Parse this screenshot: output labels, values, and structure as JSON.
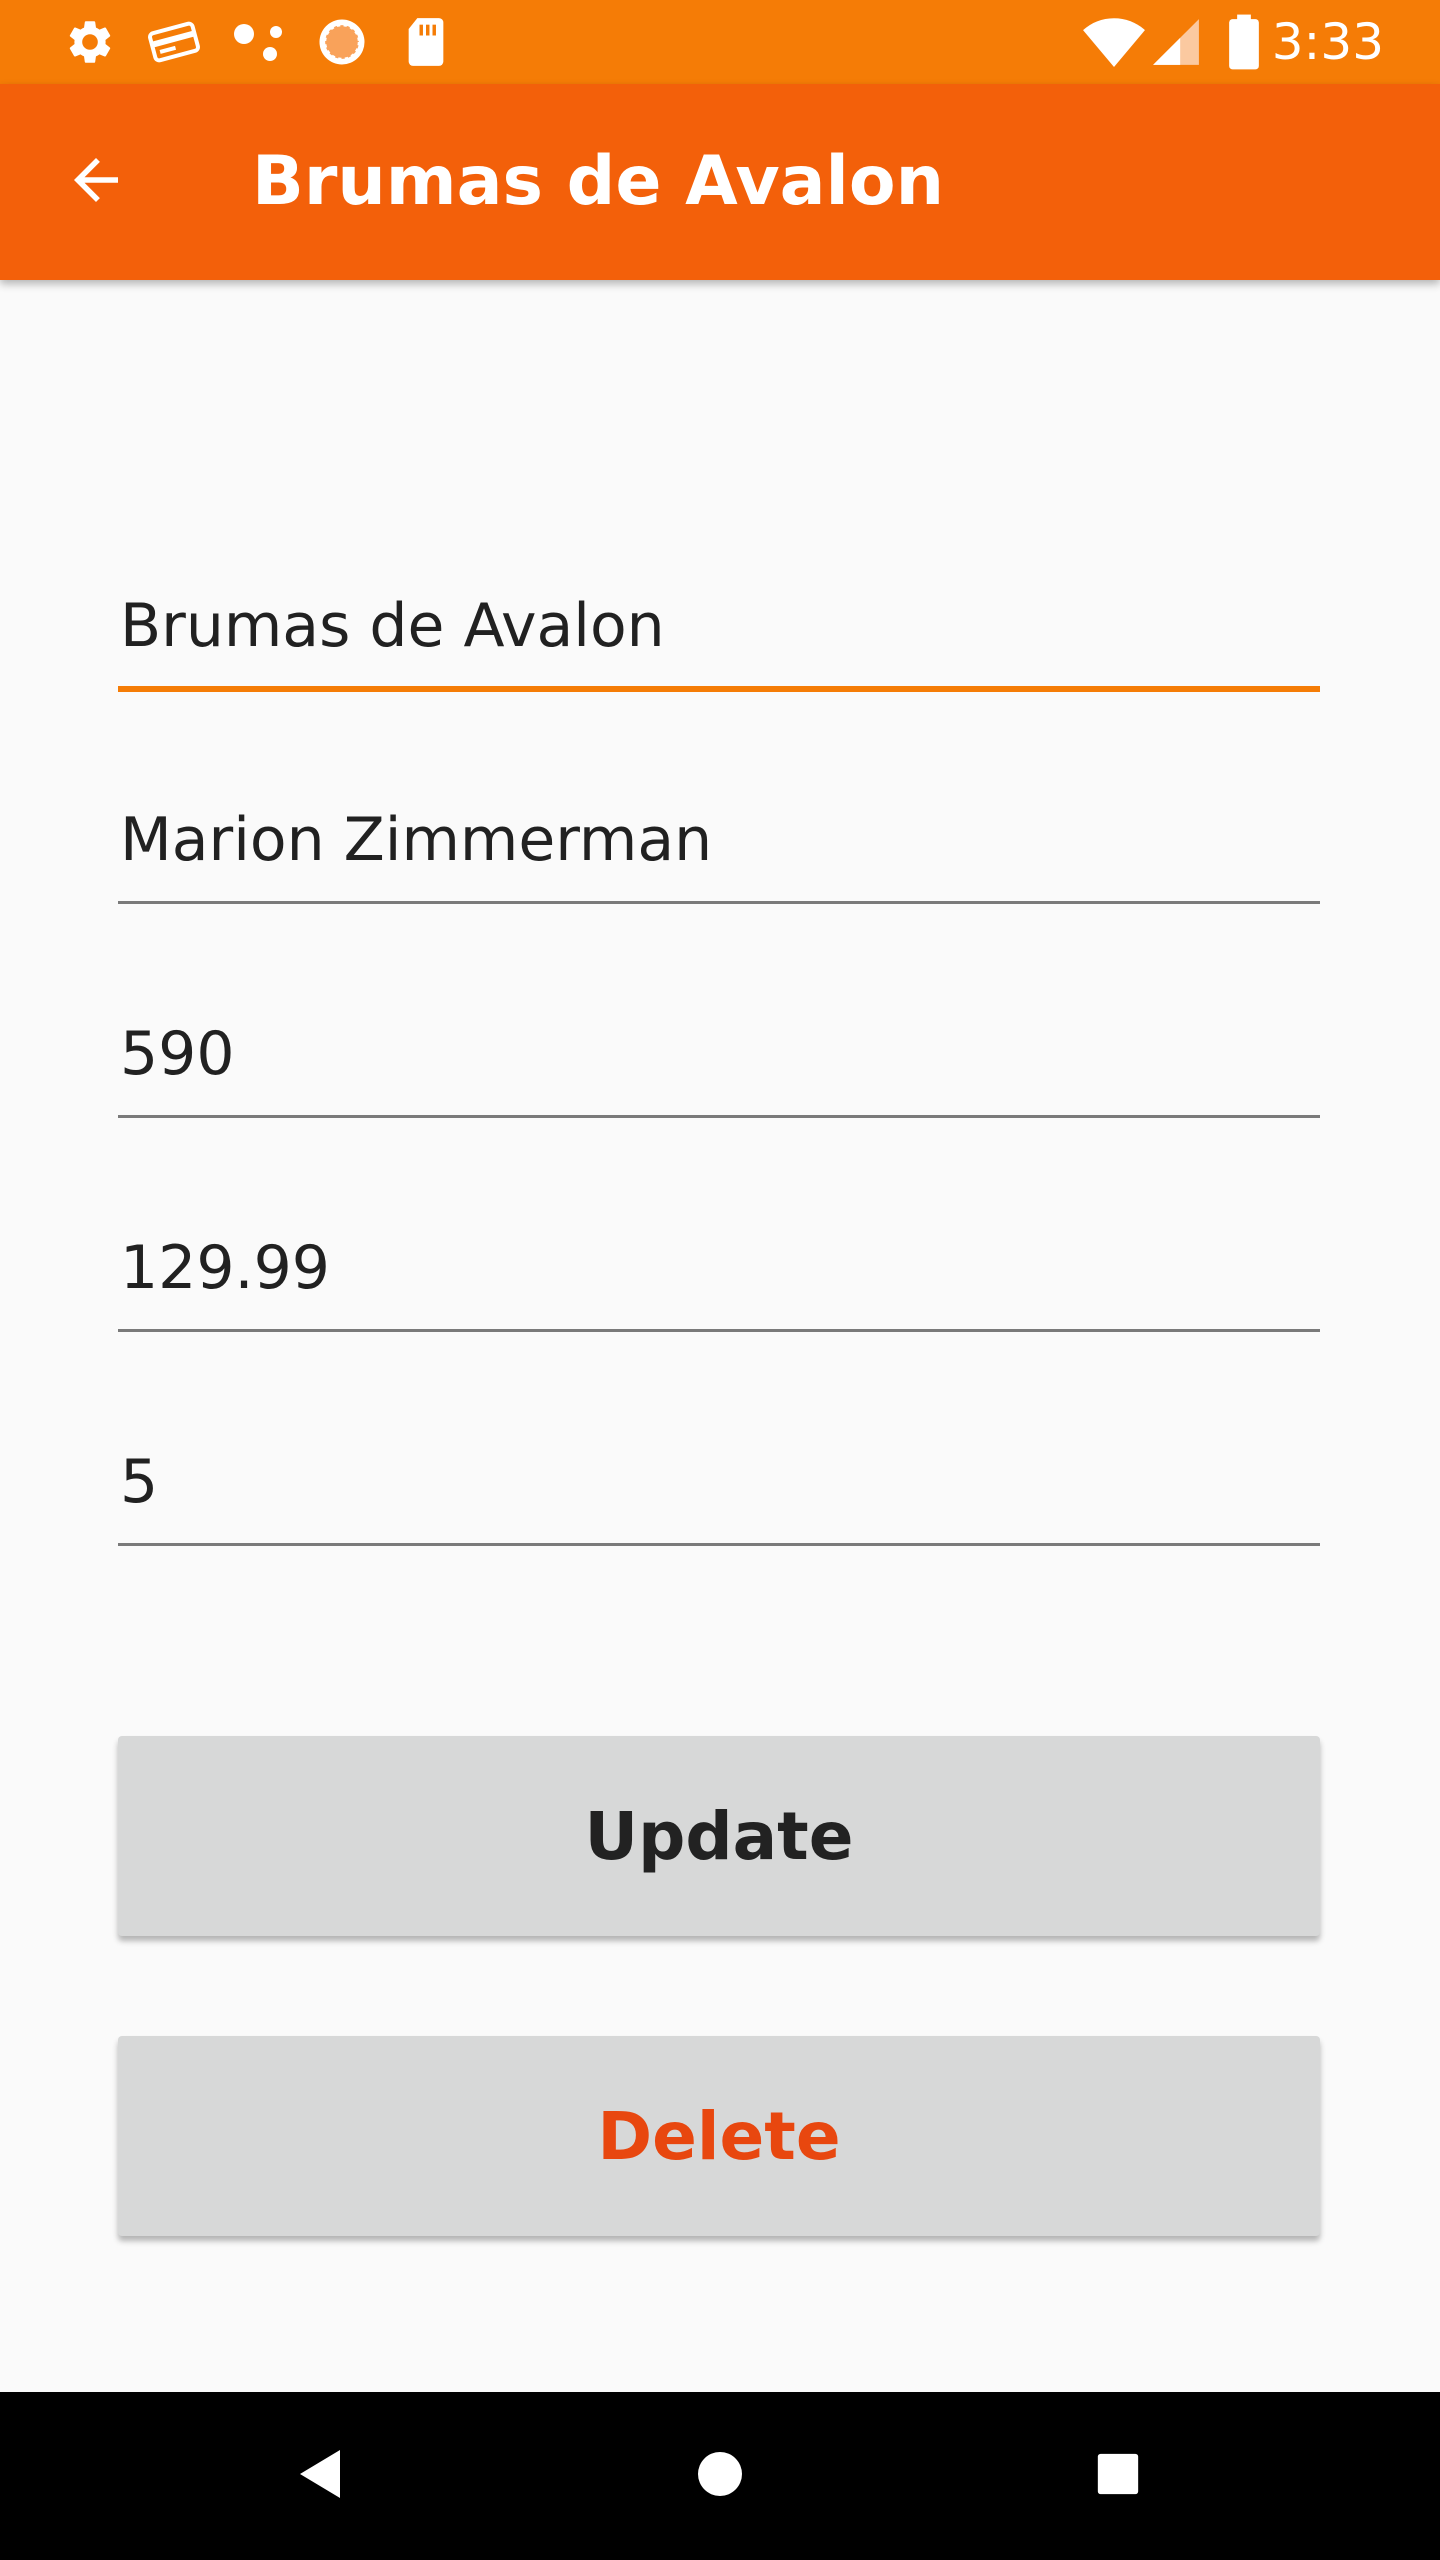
{
  "status_bar": {
    "time": "3:33",
    "icons": [
      "settings-icon",
      "card-icon",
      "dots-icon",
      "circle-app-icon",
      "sd-card-icon",
      "wifi-icon",
      "signal-icon",
      "battery-icon"
    ]
  },
  "app_bar": {
    "title": "Brumas de Avalon",
    "back_icon": "arrow-back-icon"
  },
  "form": {
    "fields": [
      {
        "value": "Brumas de Avalon",
        "focused": true
      },
      {
        "value": "Marion Zimmerman",
        "focused": false
      },
      {
        "value": "590",
        "focused": false
      },
      {
        "value": "129.99",
        "focused": false
      },
      {
        "value": "5",
        "focused": false
      }
    ],
    "update_label": "Update",
    "delete_label": "Delete"
  },
  "nav_bar": {
    "icons": [
      "nav-back-icon",
      "nav-home-icon",
      "nav-recents-icon"
    ]
  },
  "colors": {
    "status_bar": "#f57c06",
    "app_bar": "#f3600a",
    "accent": "#f57c06",
    "delete_text": "#e8470f",
    "button_bg": "#d7d8d8"
  }
}
